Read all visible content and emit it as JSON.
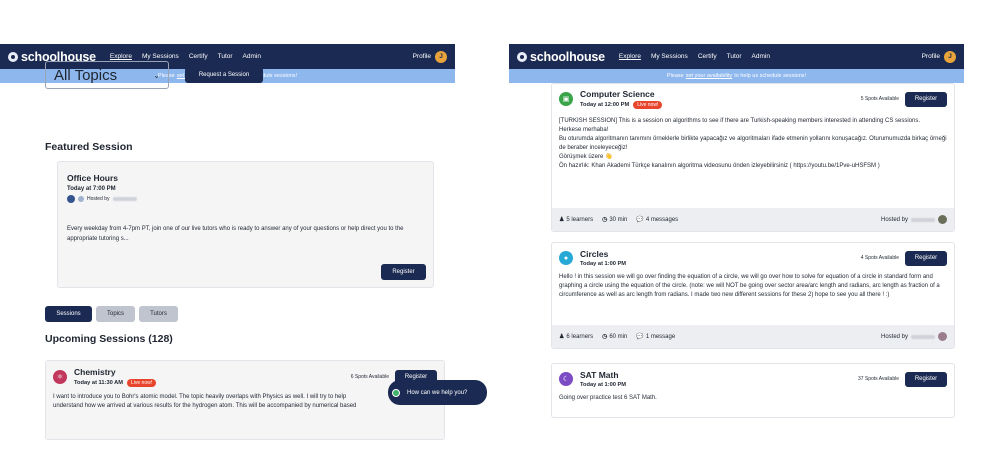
{
  "nav": {
    "logo": "schoolhouse",
    "links": [
      "Explore",
      "My Sessions",
      "Certify",
      "Tutor",
      "Admin"
    ],
    "profile": "Profile",
    "avatar_initial": "J"
  },
  "banner": {
    "prefix": "Please",
    "link": "set your availability",
    "suffix": "to help us schedule sessions!"
  },
  "left": {
    "topic_select": "All Topics",
    "request_button": "Request a Session",
    "featured_heading": "Featured Session",
    "featured": {
      "title": "Office Hours",
      "time": "Today at 7:00 PM",
      "hosted": "Hosted by",
      "description": "Every weekday from 4-7pm PT, join one of our live tutors who is ready to answer any of your questions or help direct you to the appropriate tutoring s...",
      "register": "Register"
    },
    "tabs": [
      "Sessions",
      "Topics",
      "Tutors"
    ],
    "upcoming_heading": "Upcoming Sessions (128)",
    "session": {
      "title": "Chemistry",
      "time": "Today at 11:30 AM",
      "live": "Live now!",
      "spots": "6 Spots Available",
      "register": "Register",
      "description_1": "I want to introduce you to Bohr's atomic model. The topic heavily overlaps with Physics as well. I will try to help",
      "description_2": "understand how we arrived at various results for the hydrogen atom. This will be accompanied by numerical based"
    },
    "help": "How can we help you?"
  },
  "right": {
    "cards": [
      {
        "title": "Computer Science",
        "time": "Today at 12:00 PM",
        "live": "Live now!",
        "spots": "5 Spots Available",
        "register": "Register",
        "lines": [
          "[TURKISH SESSION] This is a session on algorithms to see if there are Turkish-speaking members interested in attending CS sessions.",
          "Herkese merhaba!",
          "Bu oturumda algoritmanın tanımını örneklerle birlikte yapacağız ve algoritmaları ifade etmenin yollarını konuşacağız. Oturumumuzda birkaç örneği de beraber inceleyeceğiz!",
          "Görüşmek üzere 👋",
          "Ön hazırlık: Khan Akademi Türkçe kanalının algoritma videosunu önden izleyebilirsiniz ( https://youtu.be/1Pve-uHSFSM )"
        ],
        "learners": "5 learners",
        "duration": "30 min",
        "messages": "4 messages",
        "hosted": "Hosted by",
        "icon_color": "#3aa44a"
      },
      {
        "title": "Circles",
        "time": "Today at 1:00 PM",
        "spots": "4 Spots Available",
        "register": "Register",
        "lines": [
          "Hello ! in this session we will go over finding the equation of a circle, we will go over how to solve for equation of a circle in standard form and graphing a circle using the equation of the circle. (note: we will NOT be going over sector area/arc length and radians, arc length as fraction of a circumference as well as arc length from radians. I made two new different sessions for these 2) hope to see you all there ! :)"
        ],
        "learners": "6 learners",
        "duration": "60 min",
        "messages": "1 message",
        "hosted": "Hosted by",
        "icon_color": "#27a9d6"
      },
      {
        "title": "SAT Math",
        "time": "Today at 1:00 PM",
        "spots": "37 Spots Available",
        "register": "Register",
        "lines": [
          "Going over practice test 6 SAT Math."
        ],
        "icon_color": "#7b4cc4"
      }
    ]
  }
}
